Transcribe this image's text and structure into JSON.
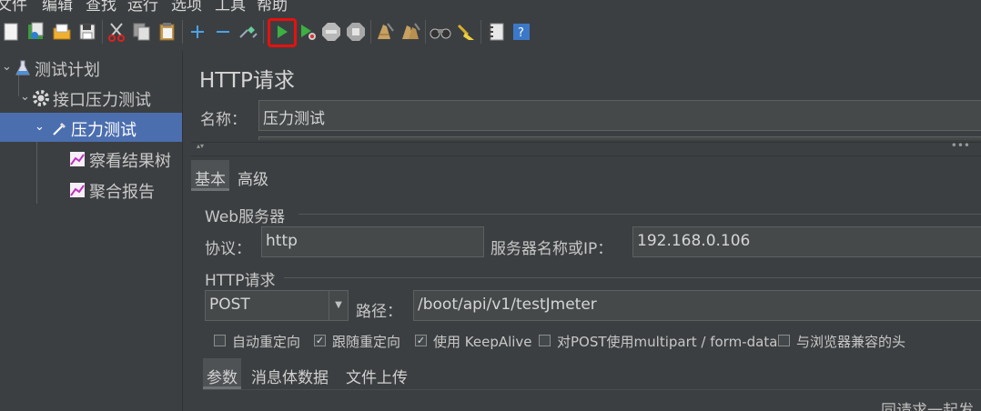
{
  "menu": [
    "文件",
    "编辑",
    "查找",
    "运行",
    "选项",
    "工具",
    "帮助"
  ],
  "toolbar_icons": [
    "new-icon",
    "templates-icon",
    "open-icon",
    "save-icon",
    "cut-icon",
    "copy-icon",
    "paste-icon",
    "expand-icon",
    "collapse-icon",
    "toggle-icon",
    "start-icon",
    "start-no-pause-icon",
    "stop-icon",
    "shutdown-icon",
    "clear-icon",
    "clear-all-icon",
    "search-icon",
    "reset-search-icon",
    "function-helper-icon",
    "help-icon"
  ],
  "tree": {
    "items": [
      {
        "label": "测试计划"
      },
      {
        "label": "接口压力测试"
      },
      {
        "label": "压力测试"
      },
      {
        "label": "察看结果树"
      },
      {
        "label": "聚合报告"
      }
    ]
  },
  "panel": {
    "title": "HTTP请求",
    "name_label": "名称：",
    "name_value": "压力测试",
    "tabs": [
      "基本",
      "高级"
    ],
    "web_server_group": "Web服务器",
    "protocol_label": "协议：",
    "protocol_value": "http",
    "server_label": "服务器名称或IP：",
    "server_value": "192.168.0.106",
    "http_group": "HTTP请求",
    "method_value": "POST",
    "path_label": "路径：",
    "path_value": "/boot/api/v1/testJmeter",
    "checkboxes": [
      {
        "label": "自动重定向",
        "checked": false
      },
      {
        "label": "跟随重定向",
        "checked": true
      },
      {
        "label": "使用 KeepAlive",
        "checked": true
      },
      {
        "label": "对POST使用multipart / form-data",
        "checked": false
      },
      {
        "label": "与浏览器兼容的头",
        "checked": false
      }
    ],
    "subtabs": [
      "参数",
      "消息体数据",
      "文件上传"
    ],
    "bottom_text": "同请求一起发"
  },
  "colors": {
    "selection": "#4b6eaf",
    "highlight": "#e8100e",
    "start": "#3cb043"
  }
}
